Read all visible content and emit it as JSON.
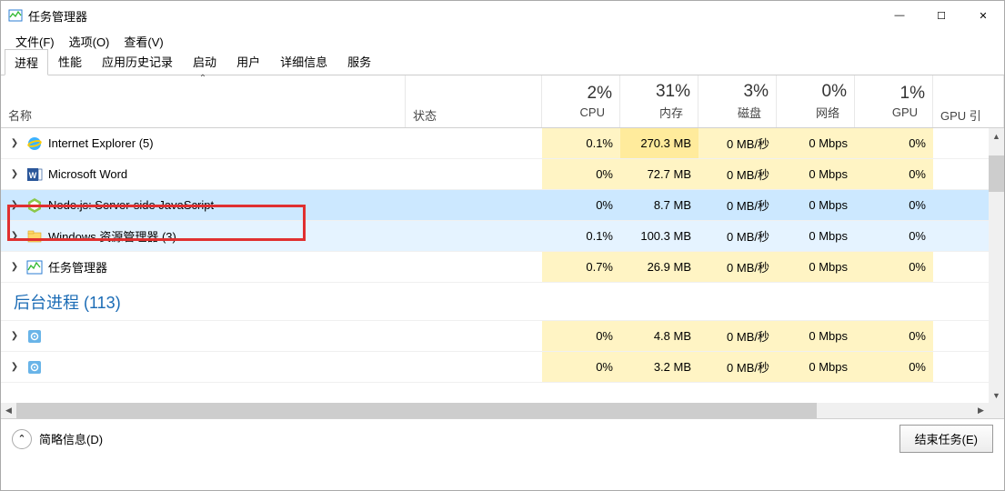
{
  "window": {
    "title": "任务管理器",
    "minimize": "—",
    "maximize": "☐",
    "close": "✕"
  },
  "menu": {
    "file": "文件(F)",
    "options": "选项(O)",
    "view": "查看(V)"
  },
  "tabs": {
    "processes": "进程",
    "performance": "性能",
    "app_history": "应用历史记录",
    "startup": "启动",
    "users": "用户",
    "details": "详细信息",
    "services": "服务"
  },
  "columns": {
    "name": "名称",
    "status": "状态",
    "cpu": {
      "value": "2%",
      "label": "CPU"
    },
    "memory": {
      "value": "31%",
      "label": "内存"
    },
    "disk": {
      "value": "3%",
      "label": "磁盘"
    },
    "network": {
      "value": "0%",
      "label": "网络"
    },
    "gpu": {
      "value": "1%",
      "label": "GPU"
    },
    "gpu_engine": "GPU 引"
  },
  "processes": [
    {
      "icon": "ie",
      "name": "Internet Explorer (5)",
      "cpu": "0.1%",
      "mem": "270.3 MB",
      "disk": "0 MB/秒",
      "net": "0 Mbps",
      "gpu": "0%",
      "cpu_shade": "shade1",
      "mem_shade": "shade2",
      "disk_shade": "shade1",
      "net_shade": "shade1",
      "gpu_shade": "shade1"
    },
    {
      "icon": "word",
      "name": "Microsoft Word",
      "cpu": "0%",
      "mem": "72.7 MB",
      "disk": "0 MB/秒",
      "net": "0 Mbps",
      "gpu": "0%",
      "cpu_shade": "shade1",
      "mem_shade": "shade1",
      "disk_shade": "shade1",
      "net_shade": "shade1",
      "gpu_shade": "shade1"
    },
    {
      "icon": "node",
      "name": "Node.js: Server-side JavaScript",
      "cpu": "0%",
      "mem": "8.7 MB",
      "disk": "0 MB/秒",
      "net": "0 Mbps",
      "gpu": "0%",
      "selected": true
    },
    {
      "icon": "explorer",
      "name": "Windows 资源管理器 (3)",
      "cpu": "0.1%",
      "mem": "100.3 MB",
      "disk": "0 MB/秒",
      "net": "0 Mbps",
      "gpu": "0%",
      "hover": true
    },
    {
      "icon": "taskmgr",
      "name": "任务管理器",
      "cpu": "0.7%",
      "mem": "26.9 MB",
      "disk": "0 MB/秒",
      "net": "0 Mbps",
      "gpu": "0%",
      "cpu_shade": "shade1",
      "mem_shade": "shade1",
      "disk_shade": "shade1",
      "net_shade": "shade1",
      "gpu_shade": "shade1"
    }
  ],
  "section": {
    "background": "后台进程 (113)"
  },
  "bg_processes": [
    {
      "icon": "gear",
      "name": "",
      "cpu": "0%",
      "mem": "4.8 MB",
      "disk": "0 MB/秒",
      "net": "0 Mbps",
      "gpu": "0%",
      "cpu_shade": "shade1",
      "mem_shade": "shade1",
      "disk_shade": "shade1",
      "net_shade": "shade1",
      "gpu_shade": "shade1"
    },
    {
      "icon": "gear",
      "name": "",
      "cpu": "0%",
      "mem": "3.2 MB",
      "disk": "0 MB/秒",
      "net": "0 Mbps",
      "gpu": "0%",
      "cpu_shade": "shade1",
      "mem_shade": "shade1",
      "disk_shade": "shade1",
      "net_shade": "shade1",
      "gpu_shade": "shade1"
    }
  ],
  "footer": {
    "brief": "简略信息(D)",
    "end_task": "结束任务(E)"
  }
}
